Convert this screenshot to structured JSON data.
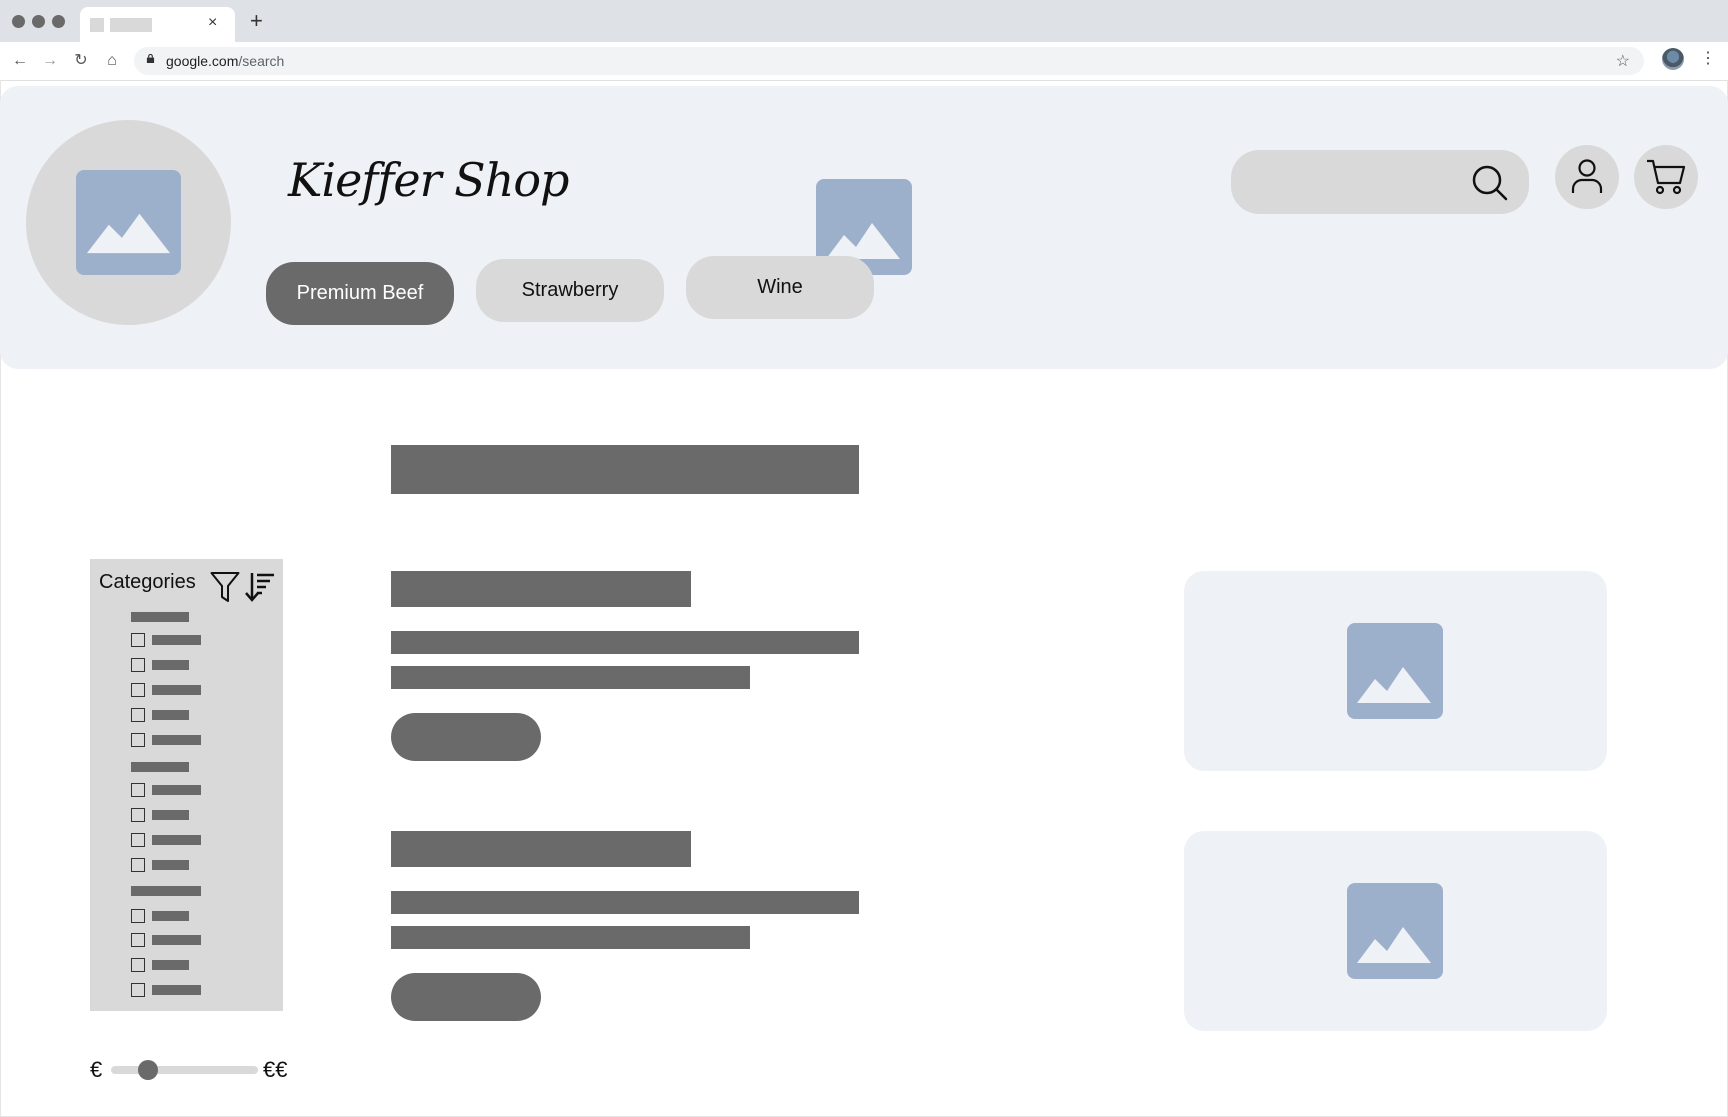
{
  "browser": {
    "tab_close": "×",
    "new_tab": "+",
    "url_host": "google.com",
    "url_path": "/search",
    "nav": {
      "back": "←",
      "forward": "→",
      "reload": "↻",
      "home": "⌂",
      "star": "☆",
      "menu": "⋮"
    }
  },
  "header": {
    "shop_name": "Kieffer Shop",
    "nav_pills": [
      {
        "label": "Premium Beef",
        "active": true
      },
      {
        "label": "Strawberry",
        "active": false
      },
      {
        "label": "Wine",
        "active": false
      }
    ],
    "search": {
      "placeholder": "",
      "icon": "search-icon"
    },
    "account_icon": "user-icon",
    "cart_icon": "cart-icon"
  },
  "sidebar": {
    "title": "Categories",
    "filter_icon": "filter-icon",
    "sort_icon": "sort-icon"
  },
  "price_filter": {
    "min_label": "€",
    "max_label": "€€",
    "value": 0.25
  },
  "colors": {
    "header_bg": "#eef1f5",
    "placeholder_gray": "#d9d9d9",
    "dark_gray": "#6a6a6a",
    "image_blue": "#9db0cb"
  }
}
